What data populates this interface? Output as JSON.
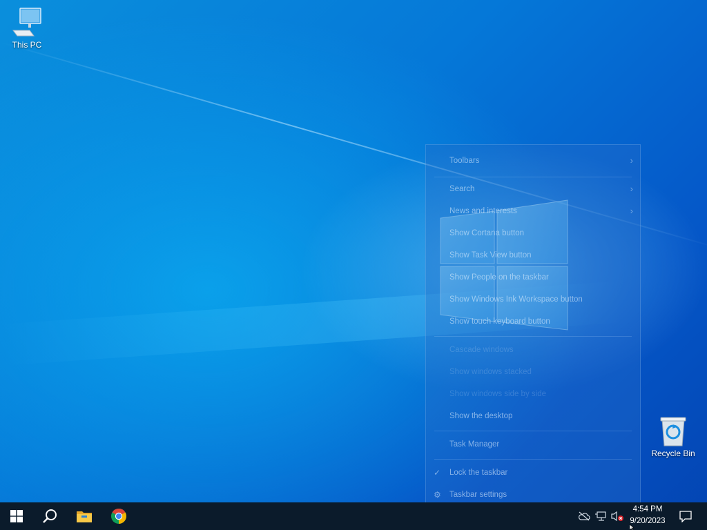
{
  "desktop": {
    "icons": [
      {
        "label": "This PC",
        "icon": "this-pc-icon"
      },
      {
        "label": "Recycle Bin",
        "icon": "recycle-bin-icon"
      }
    ]
  },
  "context_menu": {
    "items": [
      {
        "label": "Toolbars",
        "has_submenu": true
      },
      {
        "label": "Search",
        "has_submenu": true
      },
      {
        "label": "News and interests",
        "has_submenu": true
      },
      {
        "label": "Show Cortana button"
      },
      {
        "label": "Show Task View button"
      },
      {
        "label": "Show People on the taskbar"
      },
      {
        "label": "Show Windows Ink Workspace button"
      },
      {
        "label": "Show touch keyboard button"
      },
      {
        "label": "Cascade windows"
      },
      {
        "label": "Show windows stacked"
      },
      {
        "label": "Show windows side by side"
      },
      {
        "label": "Show the desktop"
      },
      {
        "label": "Task Manager"
      },
      {
        "label": "Lock the taskbar",
        "checked": true
      },
      {
        "label": "Taskbar settings",
        "icon": "gear-icon"
      }
    ],
    "submenu_arrow": "›",
    "check_mark": "✓",
    "gear_glyph": "⚙"
  },
  "taskbar": {
    "apps": [
      {
        "name": "Start",
        "icon": "windows-start-icon"
      },
      {
        "name": "Search",
        "icon": "search-icon"
      },
      {
        "name": "File Explorer",
        "icon": "file-explorer-icon"
      },
      {
        "name": "Google Chrome",
        "icon": "chrome-icon"
      }
    ],
    "tray": {
      "icons": [
        "onedrive-offline-icon",
        "network-icon",
        "volume-muted-icon"
      ]
    },
    "clock": {
      "time": "4:54 PM",
      "date": "9/20/2023"
    },
    "notification_icon": "action-center-icon"
  },
  "colors": {
    "taskbar": "#0b1b2b",
    "desktop_blue": "#0578d8",
    "chrome_red": "#db4437",
    "chrome_yellow": "#f4b400",
    "chrome_green": "#0f9d58",
    "chrome_blue": "#4285f4"
  }
}
